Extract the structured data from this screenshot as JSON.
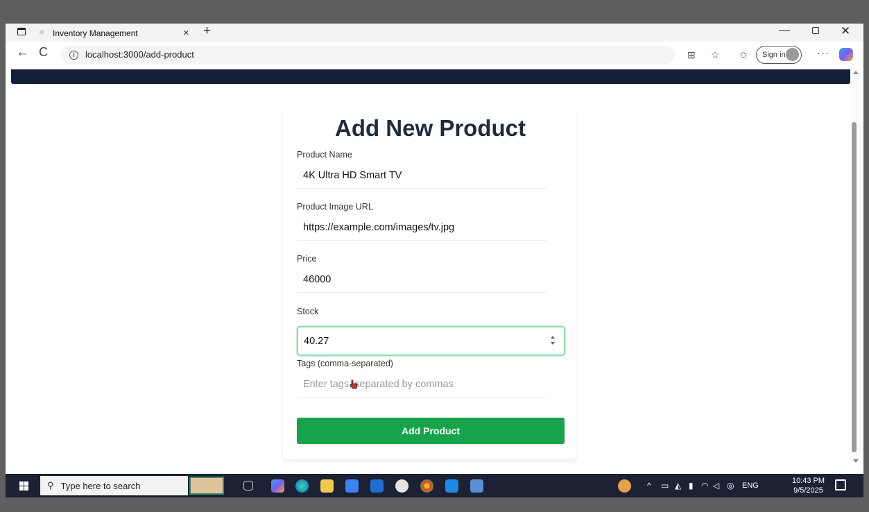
{
  "browser": {
    "tab_title": "Inventory Management",
    "tab_close": "×",
    "new_tab": "+",
    "url": "localhost:3000/add-product",
    "sign_in": "Sign in",
    "more": "···"
  },
  "window": {
    "minimize": "—",
    "close": "✕"
  },
  "nav": {
    "back": "←",
    "reload": "C"
  },
  "form": {
    "title": "Add New Product",
    "fields": {
      "name": {
        "label": "Product Name",
        "value": "4K Ultra HD Smart TV"
      },
      "image": {
        "label": "Product Image URL",
        "value": "https://example.com/images/tv.jpg"
      },
      "price": {
        "label": "Price",
        "value": "46000"
      },
      "stock": {
        "label": "Stock",
        "value": "40.27"
      },
      "tags": {
        "label": "Tags (comma-separated)",
        "placeholder": "Enter tags, separated by commas"
      }
    },
    "submit_label": "Add Product"
  },
  "taskbar": {
    "search_placeholder": "Type here to search",
    "language": "ENG",
    "time": "10:43 PM",
    "date": "9/5/2025"
  },
  "colors": {
    "accent": "#16a34a",
    "nav_strip": "#14203a",
    "focus_ring": "#8fe0aa",
    "title": "#222b3c"
  },
  "icons": [
    "tab-actions-icon",
    "back-arrow-icon",
    "reload-icon",
    "info-icon",
    "favorites-icon",
    "collections-icon",
    "copilot-icon",
    "windows-start-icon",
    "search-icon"
  ]
}
